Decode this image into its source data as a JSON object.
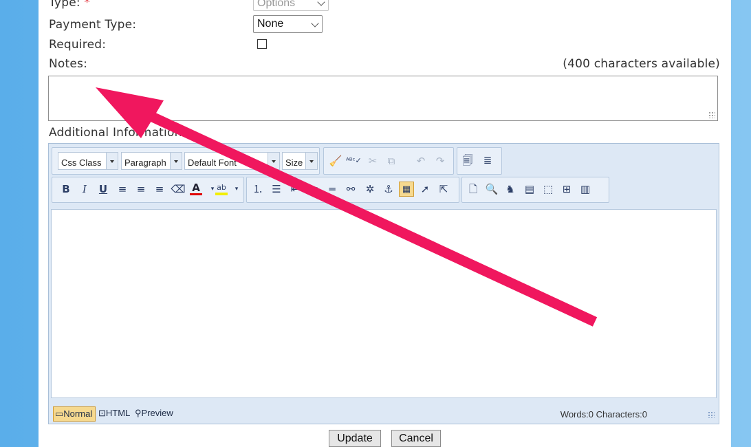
{
  "form": {
    "type_label": "Type:",
    "type_required_mark": "*",
    "type_value": "Options",
    "payment_type_label": "Payment Type:",
    "payment_type_value": "None",
    "required_label": "Required:",
    "required_checked": false,
    "notes_label": "Notes:",
    "notes_counter": "(400 characters available)",
    "notes_value": "",
    "additional_info_label": "Additional Information:"
  },
  "editor": {
    "css_class": "Css Class",
    "paragraph": "Paragraph",
    "font": "Default Font",
    "size": "Size",
    "modes": {
      "normal": "Normal",
      "html": "HTML",
      "preview": "Preview"
    },
    "counts": "Words:0 Characters:0"
  },
  "buttons": {
    "update": "Update",
    "cancel": "Cancel"
  },
  "colors": {
    "annotation_arrow": "#f0175e",
    "font_color_bar": "#e00000",
    "highlight_bar": "#f2ee00"
  }
}
